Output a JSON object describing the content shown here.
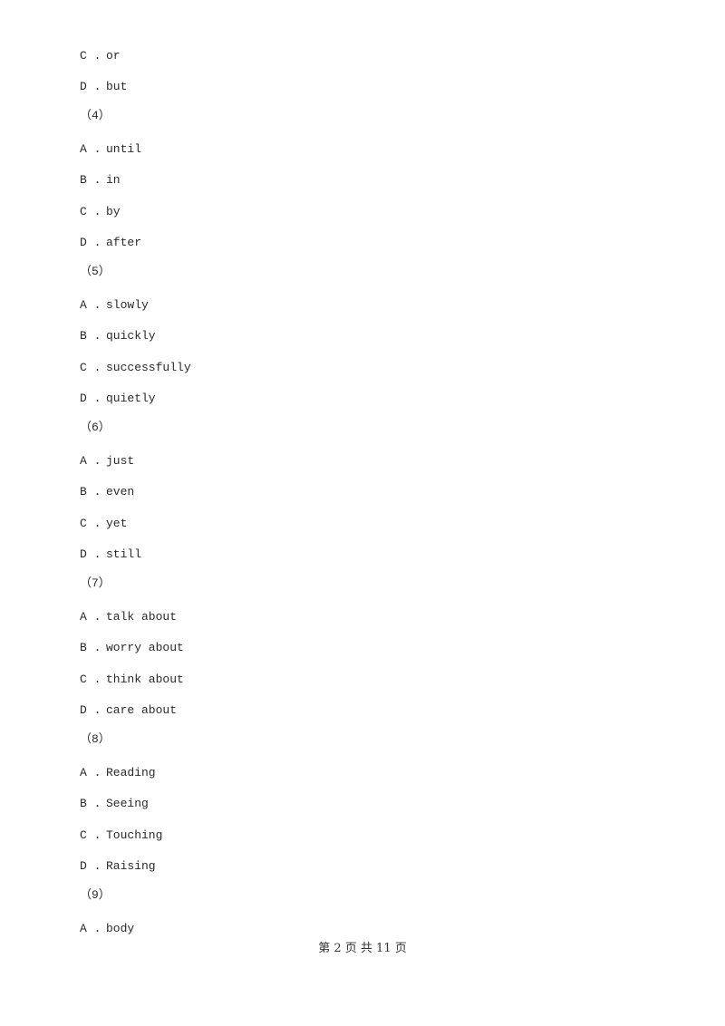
{
  "document": {
    "blocks": [
      {
        "type": "option",
        "letter": "C .",
        "text": "or"
      },
      {
        "type": "option",
        "letter": "D .",
        "text": "but"
      },
      {
        "type": "question",
        "label": "（4）"
      },
      {
        "type": "option",
        "letter": "A .",
        "text": "until"
      },
      {
        "type": "option",
        "letter": "B .",
        "text": "in"
      },
      {
        "type": "option",
        "letter": "C .",
        "text": "by"
      },
      {
        "type": "option",
        "letter": "D .",
        "text": "after"
      },
      {
        "type": "question",
        "label": "（5）"
      },
      {
        "type": "option",
        "letter": "A .",
        "text": "slowly"
      },
      {
        "type": "option",
        "letter": "B .",
        "text": "quickly"
      },
      {
        "type": "option",
        "letter": "C .",
        "text": "successfully"
      },
      {
        "type": "option",
        "letter": "D .",
        "text": "quietly"
      },
      {
        "type": "question",
        "label": "（6）"
      },
      {
        "type": "option",
        "letter": "A .",
        "text": "just"
      },
      {
        "type": "option",
        "letter": "B .",
        "text": "even"
      },
      {
        "type": "option",
        "letter": "C .",
        "text": "yet"
      },
      {
        "type": "option",
        "letter": "D .",
        "text": "still"
      },
      {
        "type": "question",
        "label": "（7）"
      },
      {
        "type": "option",
        "letter": "A .",
        "text": "talk about"
      },
      {
        "type": "option",
        "letter": "B .",
        "text": "worry about"
      },
      {
        "type": "option",
        "letter": "C .",
        "text": "think about"
      },
      {
        "type": "option",
        "letter": "D .",
        "text": "care about"
      },
      {
        "type": "question",
        "label": "（8）"
      },
      {
        "type": "option",
        "letter": "A .",
        "text": "Reading"
      },
      {
        "type": "option",
        "letter": "B .",
        "text": "Seeing"
      },
      {
        "type": "option",
        "letter": "C .",
        "text": "Touching"
      },
      {
        "type": "option",
        "letter": "D .",
        "text": "Raising"
      },
      {
        "type": "question",
        "label": "（9）"
      },
      {
        "type": "option",
        "letter": "A .",
        "text": "body"
      }
    ]
  },
  "footer": {
    "text": "第 2 页 共 11 页"
  }
}
